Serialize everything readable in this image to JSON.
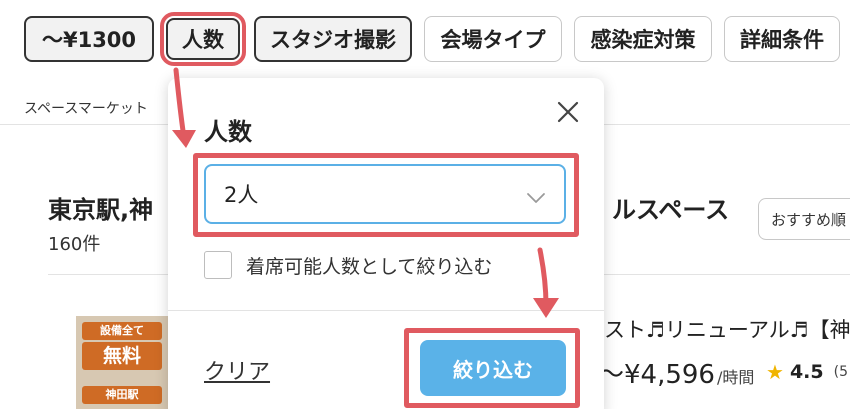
{
  "filters": {
    "price": "〜¥1300",
    "people": "人数",
    "studio": "スタジオ撮影",
    "venue_type": "会場タイプ",
    "infection": "感染症対策",
    "details": "詳細条件"
  },
  "breadcrumb": "スペースマーケット",
  "results": {
    "title_left": "東京駅,神",
    "title_right": "ルスペース",
    "count": "160件",
    "sort_label": "おすすめ順"
  },
  "listing": {
    "title": "スト♬リニューアル♬【神田",
    "price": "〜¥4,596",
    "price_unit": "/時間",
    "rating": "4.5",
    "rating_count": "(5",
    "thumb_badges": [
      "設備全て",
      "無料",
      "神田駅"
    ]
  },
  "popover": {
    "title": "人数",
    "select_value": "2人",
    "checkbox_label": "着席可能人数として絞り込む",
    "clear_label": "クリア",
    "apply_label": "絞り込む"
  },
  "colors": {
    "annotation_red": "#e05a60",
    "apply_blue": "#5ab2e8",
    "focus_blue": "#5bb0e6",
    "star_yellow": "#f0b400"
  },
  "icons": {
    "close": "close-icon",
    "dropdown": "chevron-down-icon",
    "rating": "star-icon"
  }
}
